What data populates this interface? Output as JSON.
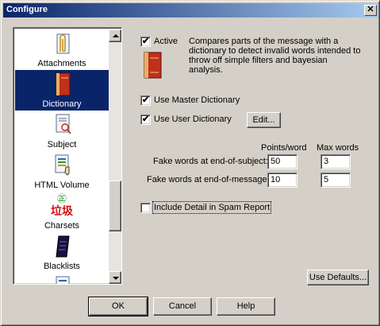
{
  "window": {
    "title": "Configure",
    "close_glyph": "✕"
  },
  "sidebar": {
    "items": [
      {
        "label": "Attachments",
        "icon": "paperclip-icon"
      },
      {
        "label": "Dictionary",
        "icon": "dictionary-book-icon",
        "selected": true
      },
      {
        "label": "Subject",
        "icon": "subject-document-icon"
      },
      {
        "label": "HTML Volume",
        "icon": "html-volume-icon"
      },
      {
        "label": "Charsets",
        "icon": "charsets-glyph-icon",
        "glyph_top": "㊣",
        "glyph_chars": "垃圾"
      },
      {
        "label": "Blacklists",
        "icon": "blacklist-book-icon"
      }
    ]
  },
  "active": {
    "label": "Active",
    "checked": true,
    "description": "Compares parts of the message with a dictionary to detect invalid words intended to throw off simple filters and bayesian analysis."
  },
  "options": {
    "use_master_dictionary": {
      "label": "Use Master Dictionary",
      "checked": true
    },
    "use_user_dictionary": {
      "label": "Use User Dictionary",
      "checked": true
    },
    "edit_button": "Edit..."
  },
  "fake_words": {
    "col_points": "Points/word",
    "col_max": "Max words",
    "subject_label": "Fake words at end-of-subject:",
    "subject_points": "50",
    "subject_max": "3",
    "message_label": "Fake words at end-of-message:",
    "message_points": "10",
    "message_max": "5"
  },
  "include_detail": {
    "label": "Include Detail in Spam Report",
    "checked": false
  },
  "buttons": {
    "use_defaults": "Use Defaults...",
    "ok": "OK",
    "cancel": "Cancel",
    "help": "Help"
  }
}
